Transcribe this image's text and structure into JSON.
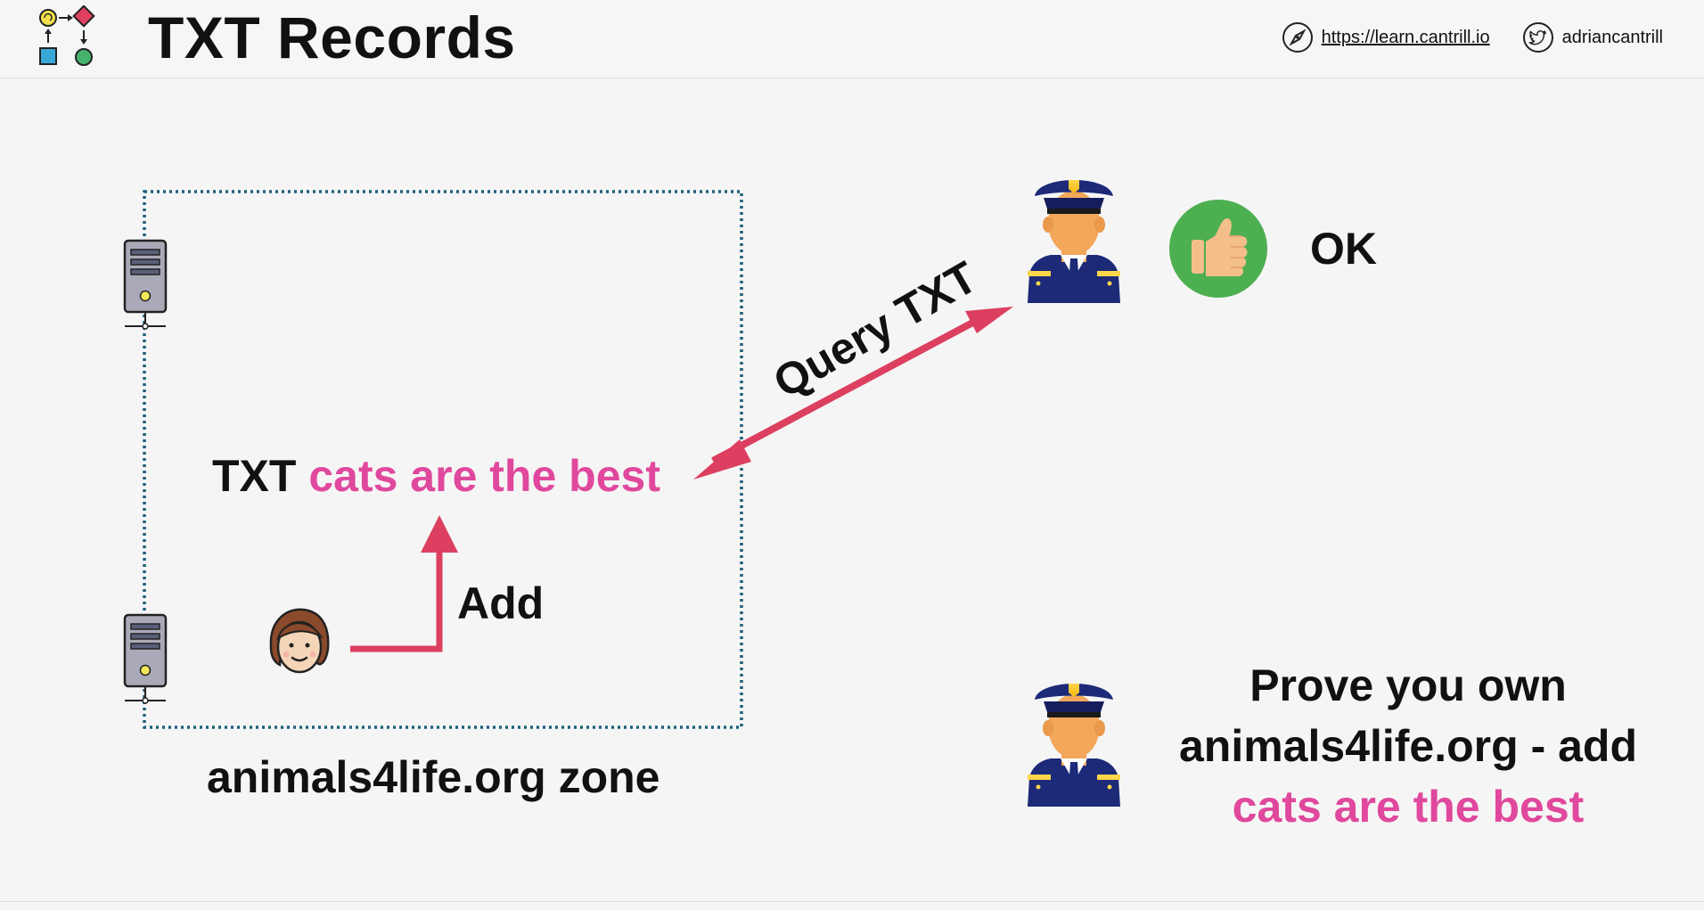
{
  "header": {
    "title": "TXT Records",
    "url_text": "https://learn.cantrill.io",
    "twitter_handle": "adriancantrill",
    "icons": [
      "diagram-logo-icon",
      "compass-icon",
      "twitter-icon"
    ]
  },
  "diagram": {
    "txt_record": {
      "prefix": "TXT",
      "value": "cats are the best"
    },
    "zone_label": "animals4life.org zone",
    "add_label": "Add",
    "query_label": "Query TXT",
    "ok_label": "OK",
    "prove": {
      "line1": "Prove you own",
      "line2": "animals4life.org - add",
      "line3": "cats are the best"
    },
    "icons": [
      "server-icon",
      "server-icon",
      "person-icon",
      "police-officer-icon",
      "police-officer-icon",
      "thumbs-up-icon"
    ]
  },
  "colors": {
    "accent_pink": "#e0489d",
    "arrow_red": "#dc3f5f",
    "zone_border": "#1d5f7a",
    "ok_green": "#4caf50",
    "police_navy": "#1c2a78"
  }
}
